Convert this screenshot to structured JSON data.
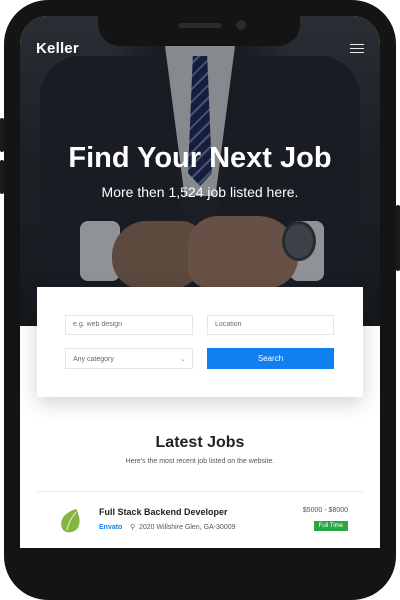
{
  "app": {
    "brand": "Keller"
  },
  "hero": {
    "title": "Find Your Next Job",
    "subtitle": "More then 1,524 job listed here."
  },
  "search": {
    "keyword_placeholder": "e.g. web design",
    "location_placeholder": "Location",
    "category_selected": "Any category",
    "button_label": "Search"
  },
  "latest": {
    "title": "Latest Jobs",
    "subtitle": "Here's the most recent job listed on the website."
  },
  "jobs": [
    {
      "title": "Full Stack Backend Developer",
      "company": "Envato",
      "location": "2020 Willshire Glen, GA-30009",
      "salary": "$5000 - $8000",
      "type": "Full Time",
      "logo_icon": "envato-leaf-icon"
    }
  ],
  "colors": {
    "accent": "#1080f0",
    "badge_green": "#28a745",
    "logo_green": "#82b541"
  }
}
